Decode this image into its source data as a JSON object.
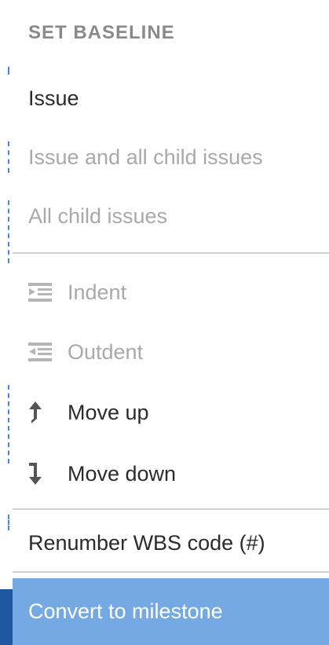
{
  "menu": {
    "header": "SET BASELINE",
    "baseline_items": [
      {
        "label": "Issue",
        "enabled": true
      },
      {
        "label": "Issue and all child issues",
        "enabled": false
      },
      {
        "label": "All child issues",
        "enabled": false
      }
    ],
    "move_items": [
      {
        "label": "Indent",
        "icon": "indent-icon",
        "enabled": false
      },
      {
        "label": "Outdent",
        "icon": "outdent-icon",
        "enabled": false
      },
      {
        "label": "Move up",
        "icon": "arrow-up-icon",
        "enabled": true
      },
      {
        "label": "Move down",
        "icon": "arrow-down-icon",
        "enabled": true
      }
    ],
    "renumber": {
      "label": "Renumber WBS code (#)"
    },
    "convert": {
      "label": "Convert to milestone",
      "highlighted": true
    }
  },
  "colors": {
    "highlight": "#74a9e3",
    "left_tab": "#1e56a0",
    "disabled_text": "#a9a9a9",
    "text": "#2b2b2b"
  }
}
